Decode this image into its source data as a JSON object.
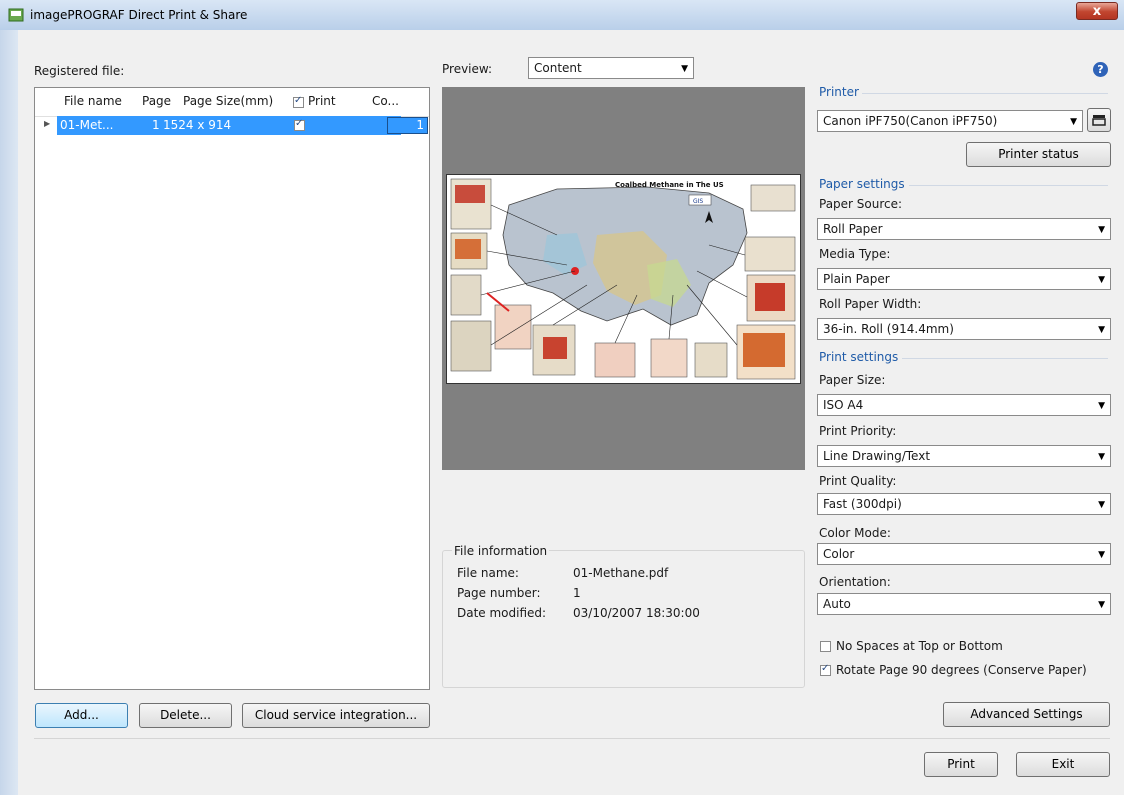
{
  "window": {
    "title": "imagePROGRAF Direct Print & Share",
    "close_glyph": "x"
  },
  "left": {
    "registered_label": "Registered file:",
    "columns": [
      "File name",
      "Page",
      "Page Size(mm)",
      "Print",
      "Co..."
    ],
    "rows": [
      {
        "file_name": "01-Met...",
        "page": "1",
        "page_size": "1524 x 914",
        "print": true,
        "copies": "1"
      }
    ],
    "buttons": {
      "add": "Add...",
      "delete": "Delete...",
      "cloud": "Cloud service integration..."
    }
  },
  "preview": {
    "label": "Preview:",
    "mode": "Content",
    "map_title": "Coalbed Methane in The US"
  },
  "file_info": {
    "title": "File information",
    "name_label": "File name:",
    "name_value": "01-Methane.pdf",
    "page_label": "Page number:",
    "page_value": "1",
    "date_label": "Date modified:",
    "date_value": "03/10/2007 18:30:00"
  },
  "right": {
    "help_glyph": "?",
    "printer_section": "Printer",
    "printer_value": "Canon iPF750(Canon iPF750)",
    "printer_status_button": "Printer status",
    "paper_section": "Paper settings",
    "paper_source_label": "Paper Source:",
    "paper_source_value": "Roll Paper",
    "media_type_label": "Media Type:",
    "media_type_value": "Plain Paper",
    "roll_width_label": "Roll Paper Width:",
    "roll_width_value": "36-in. Roll (914.4mm)",
    "print_section": "Print settings",
    "paper_size_label": "Paper Size:",
    "paper_size_value": "ISO A4",
    "print_priority_label": "Print Priority:",
    "print_priority_value": "Line Drawing/Text",
    "print_quality_label": "Print Quality:",
    "print_quality_value": "Fast (300dpi)",
    "color_mode_label": "Color Mode:",
    "color_mode_value": "Color",
    "orientation_label": "Orientation:",
    "orientation_value": "Auto",
    "no_spaces_label": "No Spaces at Top or Bottom",
    "no_spaces_checked": false,
    "rotate_label": "Rotate Page 90 degrees (Conserve Paper)",
    "rotate_checked": true,
    "advanced_button": "Advanced Settings"
  },
  "footer": {
    "print_button": "Print",
    "exit_button": "Exit"
  },
  "colors": {
    "accent": "#1f5ba8",
    "selection": "#3399ff",
    "preview_bg": "#808080"
  }
}
